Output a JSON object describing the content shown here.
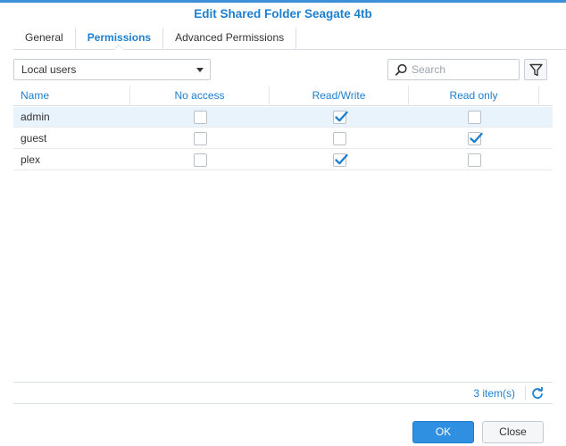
{
  "dialog": {
    "title": "Edit Shared Folder Seagate 4tb"
  },
  "tabs": [
    {
      "label": "General",
      "active": false
    },
    {
      "label": "Permissions",
      "active": true
    },
    {
      "label": "Advanced Permissions",
      "active": false
    }
  ],
  "toolbar": {
    "user_type_value": "Local users",
    "search_placeholder": "Search",
    "filter_icon": "filter-icon"
  },
  "grid": {
    "columns": [
      "Name",
      "No access",
      "Read/Write",
      "Read only"
    ],
    "rows": [
      {
        "name": "admin",
        "no_access": false,
        "read_write": true,
        "read_only": false,
        "selected": true
      },
      {
        "name": "guest",
        "no_access": false,
        "read_write": false,
        "read_only": true,
        "selected": false
      },
      {
        "name": "plex",
        "no_access": false,
        "read_write": true,
        "read_only": false,
        "selected": false
      }
    ]
  },
  "footer": {
    "item_count": "3 item(s)"
  },
  "buttons": {
    "ok_label": "OK",
    "close_label": "Close"
  },
  "colors": {
    "accent": "#1d7fcf",
    "primary_button": "#2f8fe0",
    "selected_row": "#e9f3fb"
  }
}
